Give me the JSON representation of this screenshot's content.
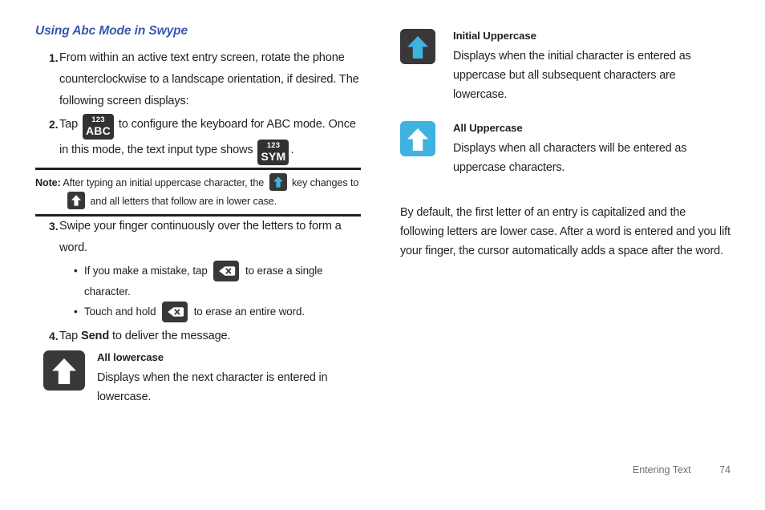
{
  "document": {
    "heading": "Using Abc Mode in Swype"
  },
  "steps": [
    {
      "number": "1.",
      "text": "From within an active text entry screen, rotate the phone counterclockwise to a landscape orientation, if desired. The following screen displays:"
    },
    {
      "number": "2.",
      "text_before": "Tap",
      "icon1": {
        "top": "123",
        "bottom": "ABC",
        "name": "abc-mode-key-icon"
      },
      "text_middle": "to configure the keyboard for ABC mode. Once in this mode, the text input type shows",
      "icon2": {
        "top": "123",
        "bottom": "SYM",
        "name": "sym-mode-key-icon"
      },
      "text_after": "."
    },
    {
      "number": "3.",
      "text": "Swipe your finger continuously over the letters to form a word.",
      "bullets": [
        {
          "text_before": "If you make a mistake, tap",
          "icon": "backspace-key-icon",
          "text_after": "to erase a single character."
        },
        {
          "text_before": "Touch and hold",
          "icon": "backspace-key-icon",
          "text_after": "to erase an entire word."
        }
      ]
    },
    {
      "number": "4.",
      "text_before": "Tap",
      "bold": "Send",
      "text_after": "to deliver the message."
    }
  ],
  "note": {
    "label": "Note:",
    "line1_before": "After typing an initial uppercase character, the",
    "line1_icon": "shift-key-cyan-icon",
    "line1_after": "key changes to",
    "line2_icon": "shift-key-white-icon",
    "line2_after": "and all letters that follow are in lower case."
  },
  "legend": {
    "left": [
      {
        "icon": "shift-all-lowercase-icon",
        "icon_style": "dark-bg-white-arrow",
        "title": "All lowercase",
        "description": "Displays when the next character is entered in lowercase."
      }
    ],
    "right": [
      {
        "icon": "shift-initial-uppercase-icon",
        "icon_style": "dark-bg-cyan-arrow",
        "title": "Initial Uppercase",
        "description": "Displays when the initial character is entered as uppercase but all subsequent characters are lowercase."
      },
      {
        "icon": "shift-all-uppercase-icon",
        "icon_style": "cyan-bg-white-arrow",
        "title": "All Uppercase",
        "description": "Displays when all characters will be entered as uppercase characters."
      }
    ]
  },
  "paragraph": "By default, the first letter of an entry is capitalized and the following letters are lower case. After a word is entered and you lift your finger, the cursor automatically adds a space after the word.",
  "footer": {
    "chapter": "Entering Text",
    "page": "74"
  },
  "colors": {
    "heading": "#3a57b0",
    "key_dark": "#3a3738",
    "accent_cyan": "#3fb3e0",
    "text": "#231f20",
    "footer_text": "#6d6e71"
  }
}
